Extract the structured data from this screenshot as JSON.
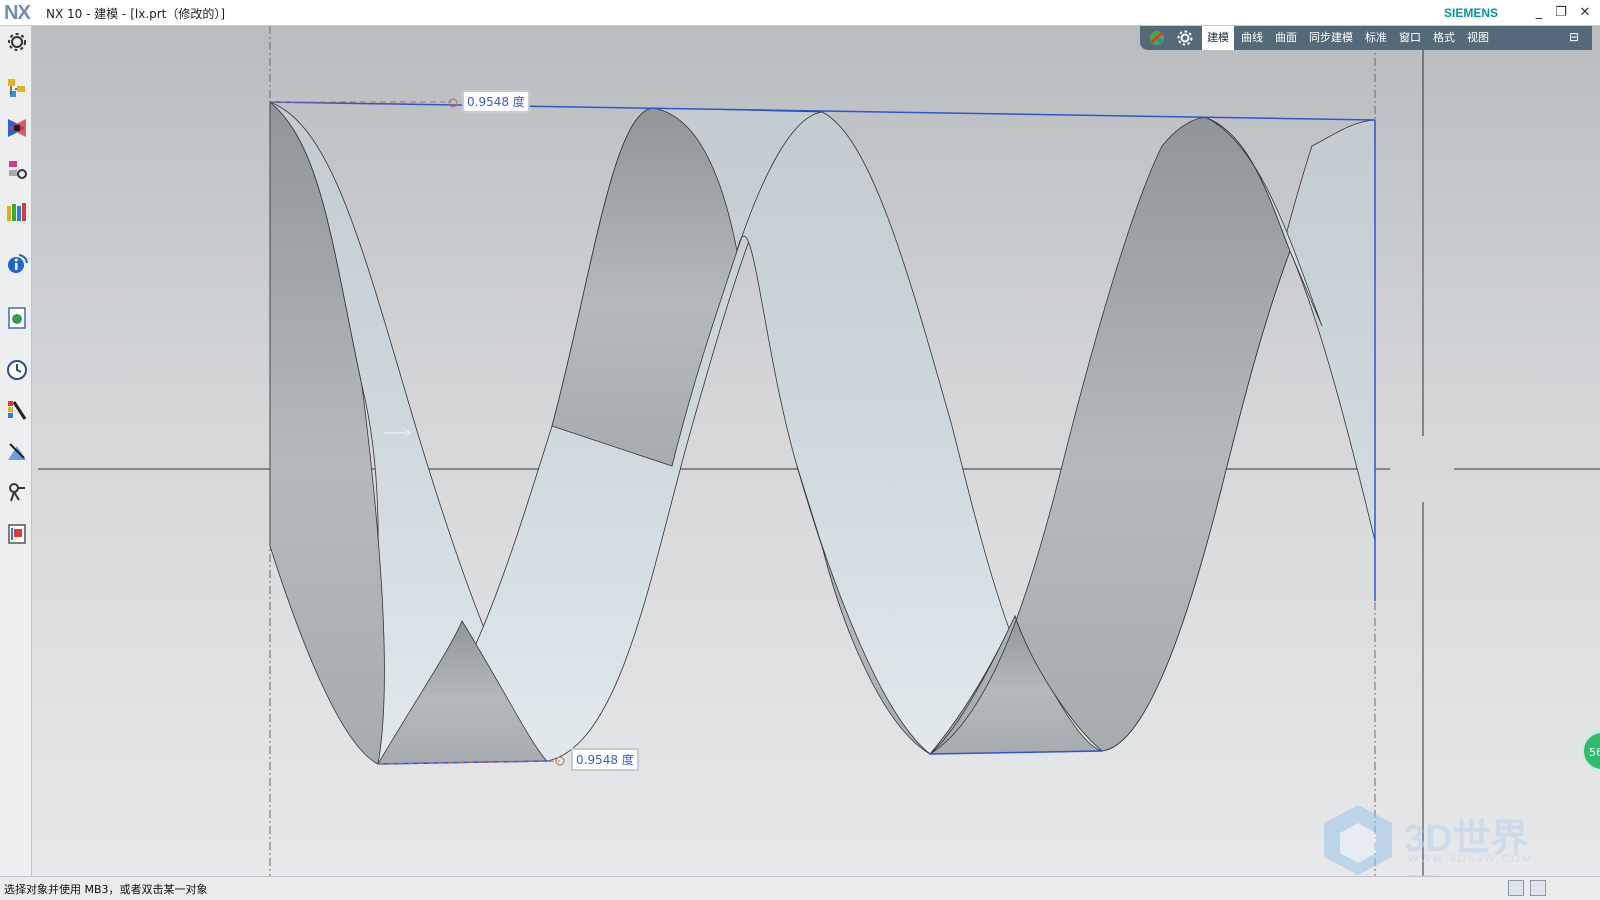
{
  "window": {
    "app_logo": "NX",
    "title": "NX 10 - 建模 - [lx.prt（修改的）]",
    "brand": "SIEMENS",
    "minimize": "_",
    "restore": "❐",
    "close": "✕"
  },
  "ribbon": {
    "tabs": [
      {
        "label": "建模",
        "active": true
      },
      {
        "label": "曲线"
      },
      {
        "label": "曲面"
      },
      {
        "label": "同步建模"
      },
      {
        "label": "标准"
      },
      {
        "label": "窗口"
      },
      {
        "label": "格式"
      },
      {
        "label": "视图"
      }
    ],
    "collapse_icon": "ribbon-collapse-icon"
  },
  "sidebar": {
    "items": [
      "settings-gear-icon",
      "assembly-navigator-icon",
      "constraint-navigator-icon",
      "part-navigator-icon",
      "reuse-library-icon",
      "info-icon",
      "web-browser-icon",
      "history-clock-icon",
      "visual-palette-icon",
      "system-materials-icon",
      "process-studio-icon",
      "roles-icon"
    ]
  },
  "viewport": {
    "dimensions": [
      {
        "label": "0.9548 度"
      },
      {
        "label": "0.9548 度"
      }
    ],
    "fps_badge": "56",
    "watermark_main": "3D世界网",
    "watermark_url": "WWW.3DSJW.COM"
  },
  "statusbar": {
    "prompt": "选择对象并使用 MB3，或者双击某一对象"
  },
  "colors": {
    "ribbon_bg": "#546a78",
    "selection_blue": "#2e55d6",
    "dimension_text": "#3a5cc8",
    "brand_teal": "#0b8fa0"
  }
}
